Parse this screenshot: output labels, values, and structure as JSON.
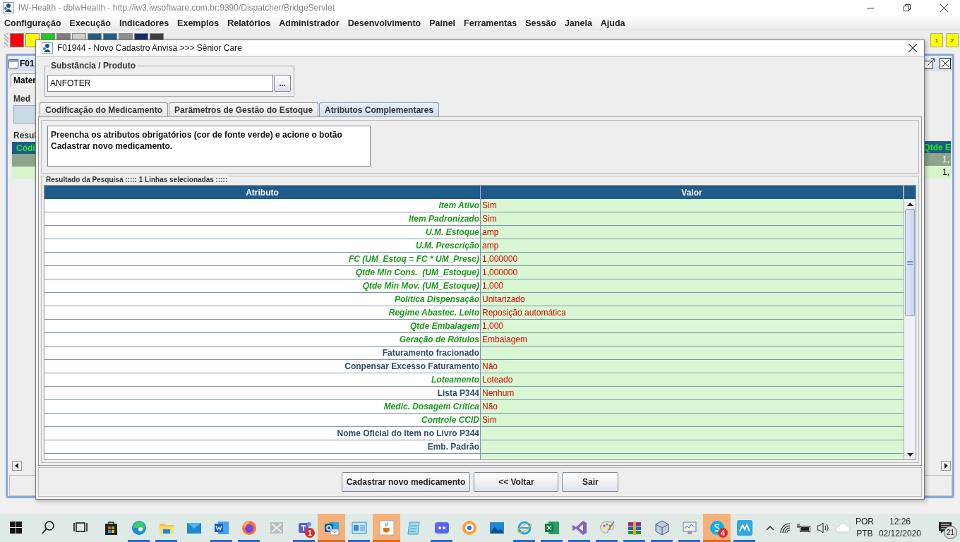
{
  "app": {
    "title": "IW-Health - dblwHealth - http://iw3.iwsoftware.com.br:9390/Dispatcher/BridgeServlet",
    "menu": [
      "Configuração",
      "Execução",
      "Indicadores",
      "Exemplos",
      "Relatórios",
      "Administrador",
      "Desenvolvimento",
      "Painel",
      "Ferramentas",
      "Sessão",
      "Janela",
      "Ajuda"
    ],
    "toolbar": [
      {
        "color": "#ff0000"
      },
      {
        "color": "#ffff00"
      },
      {
        "color": "#22cc22"
      },
      {
        "color": "#808080"
      },
      {
        "color": "#d0d0d0"
      },
      {
        "color": "#1f5f8a"
      },
      {
        "color": "#1f5f8a"
      },
      {
        "color": "#909090"
      },
      {
        "color": "#1a2a6a"
      },
      {
        "color": "#404040"
      }
    ],
    "indicators": [
      "1",
      "2"
    ]
  },
  "background_frame": {
    "title": "F01",
    "tab": "Mater",
    "group": "Med",
    "results": "Resul",
    "column_1": "Códi",
    "column_2": "Qtde E",
    "rows": [
      {
        "column_2": "1,",
        "selected": true
      },
      {
        "column_2": "1,",
        "selected": false
      }
    ]
  },
  "dialog": {
    "title": "F01944 - Novo Cadastro Anvisa >>> Sênior Care",
    "product": {
      "label": "Substância / Produto",
      "value": "ANFOTER",
      "button": "..."
    },
    "tabs": [
      {
        "label": "Codificação do Medicamento",
        "selected": false
      },
      {
        "label": "Parâmetros de Gestão do Estoque",
        "selected": false
      },
      {
        "label": "Atributos Complementares",
        "selected": true
      }
    ],
    "instructions": "Preencha os atributos obrigatórios (cor de fonte verde) e acione o botão Cadastrar novo medicamento.",
    "results_title": "Resultado da Pesquisa ::::: 1 Linhas selecionadas :::::",
    "table": {
      "columns": [
        "Atributo",
        "Valor"
      ],
      "rows": [
        {
          "attribute": "Item Ativo",
          "value": "Sim",
          "kind": "required"
        },
        {
          "attribute": "Item Padronizado",
          "value": "Sim",
          "kind": "required"
        },
        {
          "attribute": "U.M. Estoque",
          "value": "amp",
          "kind": "required"
        },
        {
          "attribute": "U.M. Prescrição",
          "value": "amp",
          "kind": "required"
        },
        {
          "attribute": "FC (UM_Estoq = FC * UM_Presc)",
          "value": "1,000000",
          "kind": "required"
        },
        {
          "attribute": "Qtde Min Cons.  (UM_Estoque)",
          "value": "1,000000",
          "kind": "required"
        },
        {
          "attribute": "Qtde Min Mov. (UM_Estoque)",
          "value": "1,000",
          "kind": "required"
        },
        {
          "attribute": "Política Dispensação",
          "value": "Unitarizado",
          "kind": "required"
        },
        {
          "attribute": "Regime Abastec. Leito",
          "value": "Reposição automática",
          "kind": "required"
        },
        {
          "attribute": "Qtde Embalagem",
          "value": "1,000",
          "kind": "required"
        },
        {
          "attribute": "Geração de Rótulos",
          "value": "Embalagem",
          "kind": "required"
        },
        {
          "attribute": "Faturamento fracionado",
          "kind": "optional"
        },
        {
          "attribute": "Conpensar Excesso Faturamento",
          "value": "Não",
          "kind": "optional"
        },
        {
          "attribute": "Loteamento",
          "value": "Loteado",
          "kind": "required"
        },
        {
          "attribute": "Lista P344",
          "value": "Nenhum",
          "kind": "optional"
        },
        {
          "attribute": "Medic. Dosagem Crítica",
          "value": "Não",
          "kind": "required"
        },
        {
          "attribute": "Controle CCID",
          "value": "Sim",
          "kind": "required"
        },
        {
          "attribute": "Nome Oficial do Item no Livro P344",
          "kind": "optional"
        },
        {
          "attribute": "Emb. Padrão",
          "kind": "optional"
        }
      ]
    },
    "buttons": [
      "Cadastrar novo medicamento",
      "<< Voltar",
      "Sair"
    ]
  },
  "taskbar": {
    "apps": [
      {
        "kind": "windows",
        "running": false,
        "active": false
      },
      {
        "kind": "search",
        "running": false,
        "active": false
      },
      {
        "kind": "taskview",
        "running": false,
        "active": false
      },
      {
        "kind": "store",
        "running": false,
        "active": false
      },
      {
        "kind": "edge",
        "running": true,
        "active": false
      },
      {
        "kind": "folder",
        "running": true,
        "active": false
      },
      {
        "kind": "mail",
        "running": false,
        "active": false
      },
      {
        "kind": "word",
        "running": true,
        "active": false
      },
      {
        "kind": "firefox",
        "running": true,
        "active": false
      },
      {
        "kind": "network",
        "running": false,
        "active": false
      },
      {
        "kind": "teams",
        "running": true,
        "active": false,
        "badge": "1"
      },
      {
        "kind": "outlook",
        "running": true,
        "active": true
      },
      {
        "kind": "panel",
        "running": true,
        "active": false
      },
      {
        "kind": "java",
        "running": true,
        "active": true
      },
      {
        "kind": "notepad",
        "running": false,
        "active": false
      },
      {
        "kind": "discord",
        "running": true,
        "active": false
      },
      {
        "kind": "ring",
        "running": false,
        "active": false
      },
      {
        "kind": "photos",
        "running": false,
        "active": false
      },
      {
        "kind": "ie",
        "running": true,
        "active": false
      },
      {
        "kind": "excel",
        "running": true,
        "active": false
      },
      {
        "kind": "vs",
        "running": true,
        "active": false
      },
      {
        "kind": "paint",
        "running": true,
        "active": false
      },
      {
        "kind": "winrar",
        "running": true,
        "active": false
      },
      {
        "kind": "cube",
        "running": true,
        "active": false
      },
      {
        "kind": "monitor",
        "running": true,
        "active": false
      },
      {
        "kind": "skype",
        "running": true,
        "active": true,
        "badge": "4"
      },
      {
        "kind": "tiles",
        "running": true,
        "active": false
      }
    ],
    "tray": {
      "language": [
        "POR",
        "PTB"
      ],
      "time": "12:26",
      "date": "02/12/2020",
      "notifications": "21"
    }
  }
}
